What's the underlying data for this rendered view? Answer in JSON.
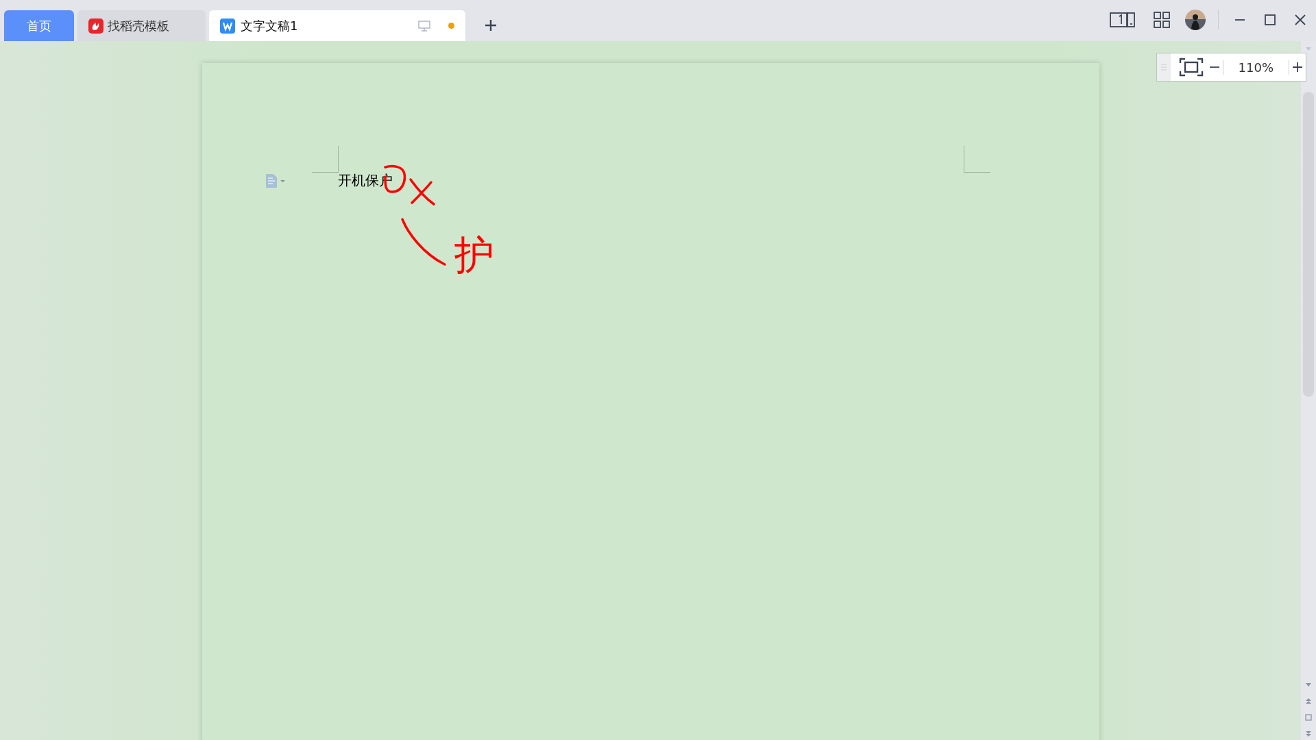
{
  "tabs": [
    {
      "label": "首页",
      "selected": false,
      "kind": "home"
    },
    {
      "label": "找稻壳模板",
      "selected": false,
      "kind": "template"
    },
    {
      "label": "文字文稿1",
      "selected": true,
      "kind": "document",
      "unsaved": true
    }
  ],
  "document": {
    "paragraphs": [
      "开机保户"
    ],
    "annotations": [
      {
        "kind": "circle"
      },
      {
        "kind": "cross"
      },
      {
        "kind": "stroke"
      },
      {
        "kind": "text",
        "text": "护"
      }
    ]
  },
  "zoom": {
    "value": "110%"
  }
}
